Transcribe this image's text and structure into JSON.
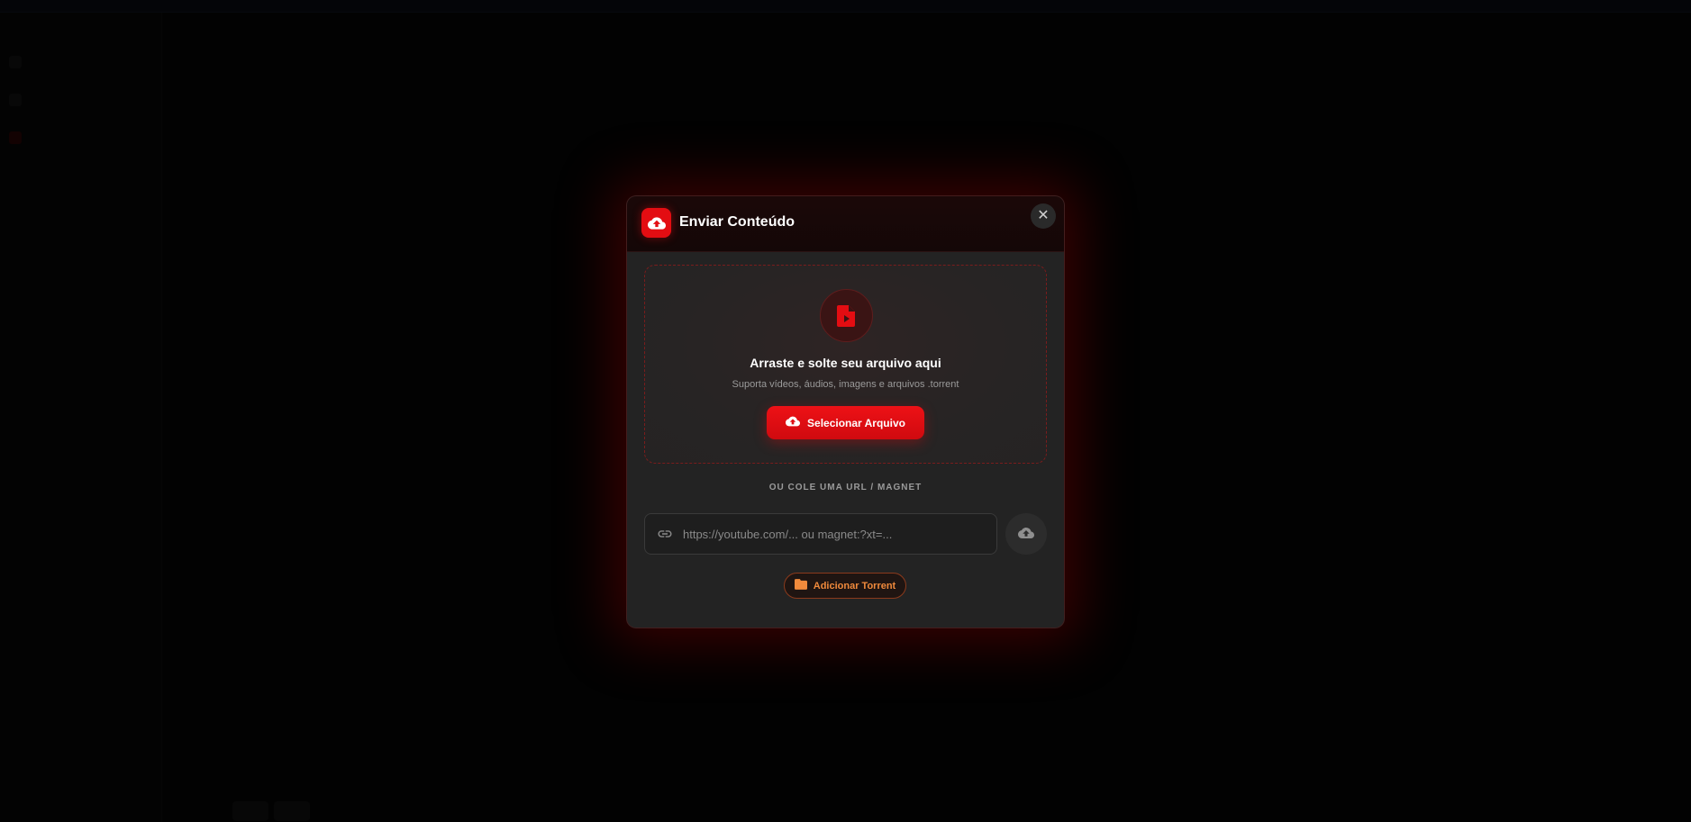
{
  "background": {
    "topbar_text": "",
    "sidebar_items": [
      "",
      "",
      ""
    ],
    "page_title": "",
    "section_title": ""
  },
  "modal": {
    "title": "Enviar Conteúdo",
    "header_icon": "cloud-upload-icon",
    "close_icon": "close-icon",
    "close_glyph": "✕",
    "dropzone": {
      "icon": "file-video-icon",
      "title": "Arraste e solte seu arquivo aqui",
      "subtitle": "Suporta vídeos, áudios, imagens e arquivos .torrent",
      "select_button_label": "Selecionar Arquivo",
      "select_button_icon": "cloud-upload-icon"
    },
    "divider_text": "OU COLE UMA URL / MAGNET",
    "url_input": {
      "icon": "link-icon",
      "value": "",
      "placeholder": "https://youtube.com/... ou magnet:?xt=..."
    },
    "url_submit_icon": "cloud-upload-icon",
    "torrent_button": {
      "label": "Adicionar Torrent",
      "icon": "folder-icon"
    }
  },
  "colors": {
    "accent_red": "#e30d12",
    "torrent_orange": "#f08a3c",
    "modal_bg": "#232323"
  }
}
